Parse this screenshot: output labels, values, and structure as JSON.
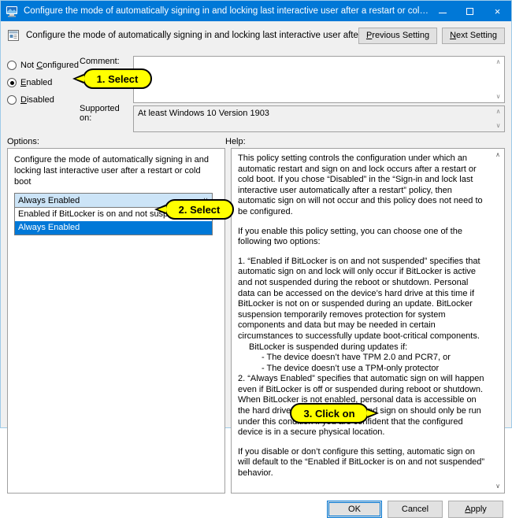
{
  "window": {
    "title": "Configure the mode of automatically signing in and locking last interactive user after a restart or cold boot",
    "icon": "policy-setting-icon",
    "minimize_label": "",
    "maximize_label": "",
    "close_label": "×"
  },
  "header": {
    "icon": "policy-document-icon",
    "title": "Configure the mode of automatically signing in and locking last interactive user after a restart or cold boot",
    "previous_setting": "Previous Setting",
    "previous_setting_accel": "P",
    "next_setting": "Next Setting",
    "next_setting_accel": "N"
  },
  "state": {
    "options": [
      {
        "label": "Not Configured",
        "accel": "C",
        "selected": false
      },
      {
        "label": "Enabled",
        "accel": "E",
        "selected": true
      },
      {
        "label": "Disabled",
        "accel": "D",
        "selected": false
      }
    ],
    "not_configured_pre": "Not ",
    "not_configured_accel": "C",
    "not_configured_post": "onfigured",
    "enabled_accel": "E",
    "enabled_post": "nabled",
    "disabled_accel": "D",
    "disabled_post": "isabled"
  },
  "comment": {
    "label": "Comment:",
    "value": "",
    "scroll_up": "∧",
    "scroll_down": "∨"
  },
  "supported_on": {
    "label": "Supported on:",
    "value": "At least Windows 10 Version 1903",
    "scroll_up": "∧",
    "scroll_down": "∨"
  },
  "options_panel": {
    "label": "Options:",
    "description": "Configure the mode of automatically signing in and locking last interactive user after a restart or cold boot",
    "combo": {
      "value": "Always Enabled",
      "chevron": "∨",
      "expanded": true,
      "items": [
        {
          "label": "Enabled if BitLocker is on and not suspended",
          "selected": false
        },
        {
          "label": "Always Enabled",
          "selected": true
        }
      ]
    }
  },
  "help_panel": {
    "label": "Help:",
    "scroll_up": "∧",
    "scroll_down": "∨",
    "paragraphs": {
      "p1": "This policy setting controls the configuration under which an automatic restart and sign on and lock occurs after a restart or cold boot. If you chose “Disabled” in the “Sign-in and lock last interactive user automatically after a restart” policy, then automatic sign on will not occur and this policy does not need to be configured.",
      "p2": "If you enable this policy setting, you can choose one of the following two options:",
      "p3": "1. “Enabled if BitLocker is on and not suspended” specifies that automatic sign on and lock will only occur if BitLocker is active and not suspended during the reboot or shutdown. Personal data can be accessed on the device’s hard drive at this time if BitLocker is not on or suspended during an update. BitLocker suspension temporarily removes protection for system components and data but may be needed in certain circumstances to successfully update boot-critical components.",
      "p3_sub_intro": "BitLocker is suspended during updates if:",
      "p3_bullet1": "- The device doesn’t have TPM 2.0 and PCR7, or",
      "p3_bullet2": "- The device doesn’t use a TPM-only protector",
      "p4": "2. “Always Enabled” specifies that automatic sign on will happen even if BitLocker is off or suspended during reboot or shutdown. When BitLocker is not enabled, personal data is accessible on the hard drive. Automatic restart and sign on should only be run under this condition if you are confident that the configured device is in a secure physical location.",
      "p5": "If you disable or don’t configure this setting, automatic sign on will default to the “Enabled if BitLocker is on and not suspended” behavior."
    }
  },
  "footer": {
    "ok": "OK",
    "cancel": "Cancel",
    "apply": "Apply",
    "apply_accel": "A"
  },
  "callouts": [
    {
      "id": 1,
      "text": "1. Select"
    },
    {
      "id": 2,
      "text": "2. Select"
    },
    {
      "id": 3,
      "text": "3. Click on"
    }
  ],
  "colors": {
    "titlebar": "#0078d7",
    "dialog_bg": "#f0f0f0",
    "selection": "#0078d7",
    "combo_bg": "#cce4f7",
    "callout_yellow": "#ffff00",
    "window_border": "#9ecbe8"
  }
}
